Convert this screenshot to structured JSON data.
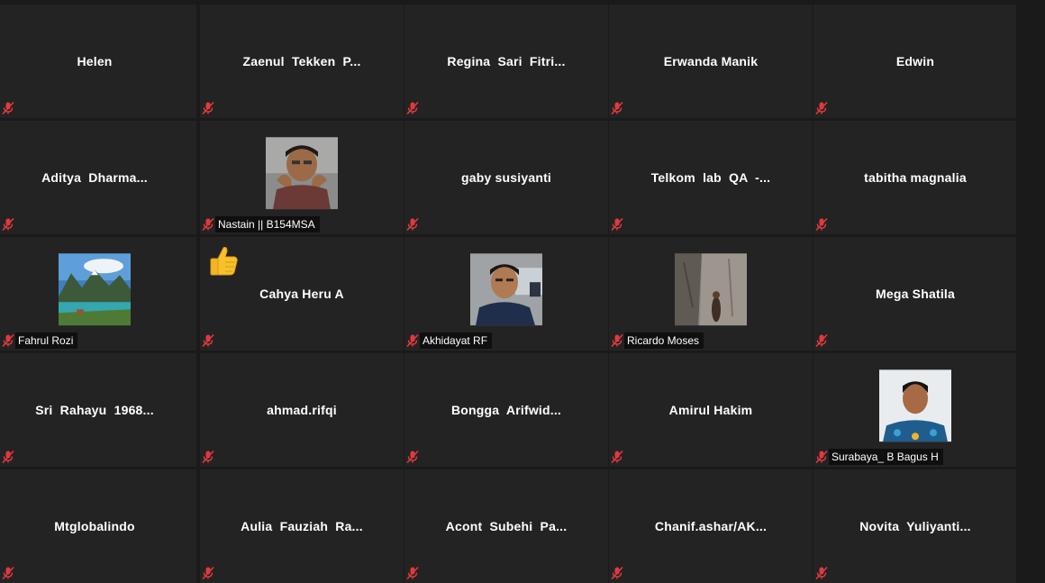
{
  "meeting": {
    "participants": [
      {
        "name": "Helen",
        "show_label": false,
        "muted": true
      },
      {
        "name": "Zaenul  Tekken  P...",
        "show_label": false,
        "muted": true
      },
      {
        "name": "Regina  Sari  Fitri...",
        "show_label": false,
        "muted": true
      },
      {
        "name": "Erwanda Manik",
        "show_label": false,
        "muted": true
      },
      {
        "name": "Edwin",
        "show_label": false,
        "muted": true
      },
      {
        "name": "Aditya  Dharma...",
        "show_label": false,
        "muted": true
      },
      {
        "name": "Nastain || B154MSA",
        "show_label": true,
        "muted": true,
        "photo": "man-hands-on-face"
      },
      {
        "name": "gaby susiyanti",
        "show_label": false,
        "muted": true
      },
      {
        "name": "Telkom  lab  QA  -...",
        "show_label": false,
        "muted": true
      },
      {
        "name": "tabitha magnalia",
        "show_label": false,
        "muted": true
      },
      {
        "name": "Fahrul Rozi",
        "show_label": true,
        "muted": true,
        "photo": "mountain-lake"
      },
      {
        "name": "Cahya Heru A",
        "show_label": false,
        "muted": true,
        "reaction": "thumbs-up"
      },
      {
        "name": "Akhidayat RF",
        "show_label": true,
        "muted": true,
        "photo": "man-smiling"
      },
      {
        "name": "Ricardo Moses",
        "show_label": true,
        "muted": true,
        "photo": "rock-cliff"
      },
      {
        "name": "Mega Shatila",
        "show_label": false,
        "muted": true
      },
      {
        "name": "Sri  Rahayu  1968...",
        "show_label": false,
        "muted": true
      },
      {
        "name": "ahmad.rifqi",
        "show_label": false,
        "muted": true
      },
      {
        "name": "Bongga  Arifwid...",
        "show_label": false,
        "muted": true
      },
      {
        "name": "Amirul Hakim",
        "show_label": false,
        "muted": true
      },
      {
        "name": "Surabaya_ B Bagus H",
        "show_label": true,
        "muted": true,
        "photo": "man-batik"
      },
      {
        "name": "Mtglobalindo",
        "show_label": false,
        "muted": true
      },
      {
        "name": "Aulia  Fauziah  Ra...",
        "show_label": false,
        "muted": true
      },
      {
        "name": "Acont  Subehi  Pa...",
        "show_label": false,
        "muted": true
      },
      {
        "name": "Chanif.ashar/AK...",
        "show_label": false,
        "muted": true
      },
      {
        "name": "Novita  Yuliyanti...",
        "show_label": false,
        "muted": true
      }
    ]
  },
  "colors": {
    "tile": "#232323",
    "background": "#1a1a1a",
    "mute": "#e0393e",
    "text": "#ffffff"
  },
  "icons": {
    "mute": "microphone-muted-icon",
    "reaction": "thumbs-up-icon"
  }
}
